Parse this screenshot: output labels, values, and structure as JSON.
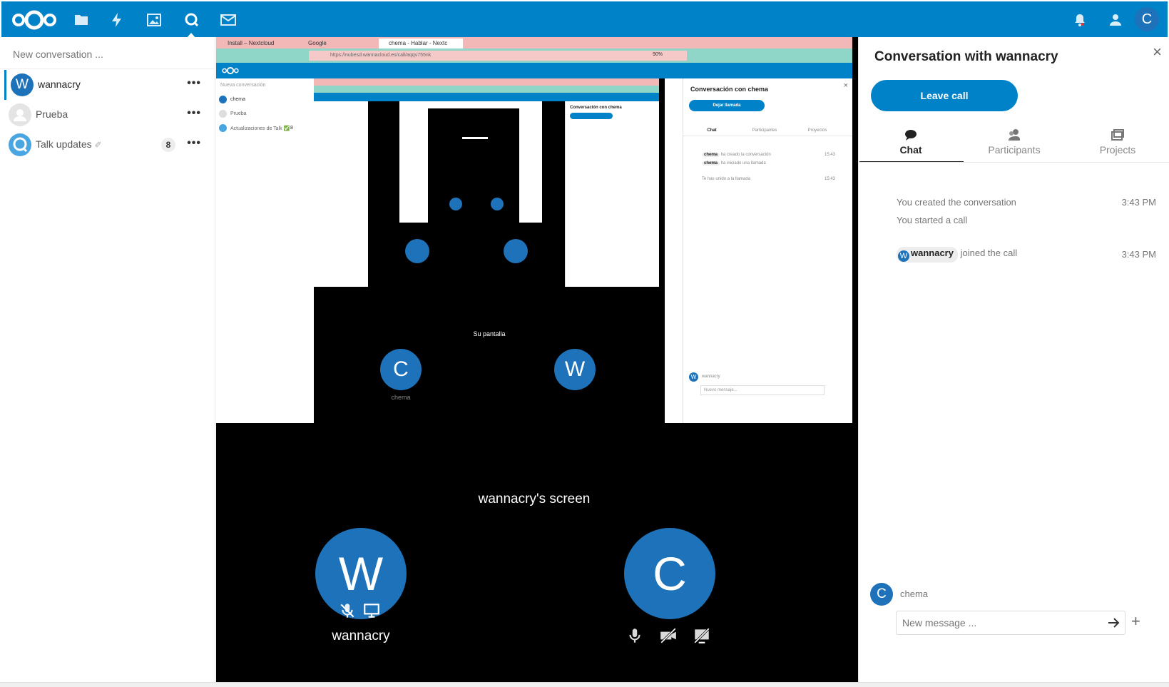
{
  "colors": {
    "primary": "#0082c9",
    "avatar": "#1e72b9",
    "dark": "#000000"
  },
  "header": {
    "nav_icons": [
      "files-icon",
      "activity-icon",
      "photos-icon",
      "talk-icon",
      "mail-icon"
    ],
    "avatar_initial": "C"
  },
  "sidebar": {
    "search_placeholder": "New conversation ...",
    "conversations": [
      {
        "name": "wannacry",
        "initial": "W",
        "color": "#1e72b9",
        "active": true,
        "badge": ""
      },
      {
        "name": "Prueba",
        "initial": "",
        "color": "#e0e0e0",
        "active": false,
        "badge": ""
      },
      {
        "name": "Talk updates",
        "initial": "",
        "color": "#49a6e0",
        "active": false,
        "badge": "8"
      }
    ]
  },
  "call": {
    "screen_label": "wannacry's screen",
    "participants": [
      {
        "name": "wannacry",
        "initial": "W"
      },
      {
        "name": "",
        "initial": "C"
      }
    ],
    "nested": {
      "tabs": [
        "Install – Nextcloud",
        "Google",
        "chema - Hablar - Nextc"
      ],
      "url": "https://nubesd.wannacloud.es/call/aqqv755nk",
      "zoom": "90%",
      "sidebar_search": "Nueva conversación",
      "conversations": [
        "chema",
        "Prueba",
        "Actualizaciones de Talk ✅"
      ],
      "badge": "8",
      "panel_title": "Conversación con chema",
      "leave_btn": "Dejar llamada",
      "tabs_panel": [
        "Chat",
        "Participantes",
        "Proyectos"
      ],
      "messages": [
        {
          "text": "ha creado la conversación",
          "time": "15:43"
        },
        {
          "text": "ha iniciado una llamada",
          "time": ""
        },
        {
          "text": "Te has unido a la llamada",
          "time": "15:43"
        }
      ],
      "composer_name": "wannacry",
      "composer_placeholder": "Nuevo mensaje...",
      "screen_label": "Su pantalla",
      "p1_name": "chema",
      "p1_initial": "C",
      "p2_initial": "W"
    }
  },
  "right_sidebar": {
    "title": "Conversation with wannacry",
    "close": "×",
    "leave_call": "Leave call",
    "tabs": [
      "Chat",
      "Participants",
      "Projects"
    ],
    "messages": [
      {
        "text": "You created the conversation",
        "time": "3:43 PM"
      },
      {
        "text": "You started a call",
        "time": ""
      }
    ],
    "joined": {
      "user": "wannacry",
      "initial": "W",
      "text": "joined the call",
      "time": "3:43 PM"
    },
    "composer": {
      "user": "chema",
      "initial": "C",
      "placeholder": "New message ..."
    }
  }
}
